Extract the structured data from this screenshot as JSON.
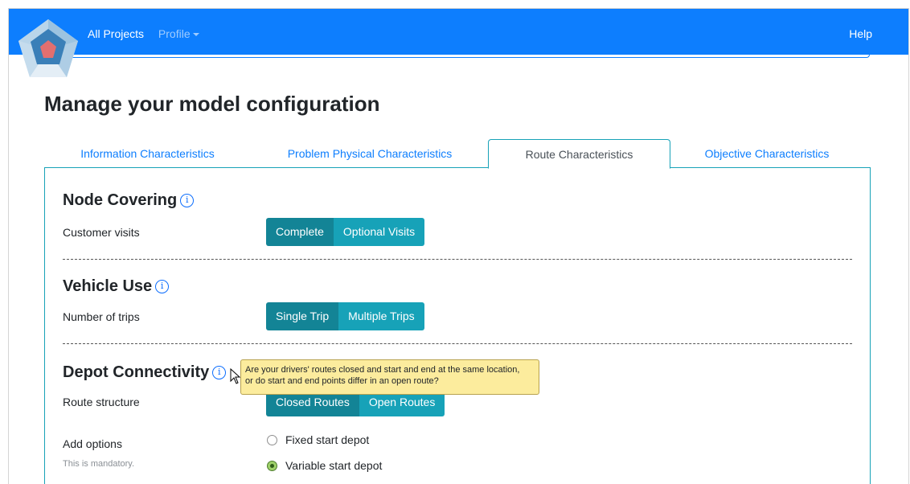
{
  "nav": {
    "all_projects": "All Projects",
    "profile": "Profile",
    "help": "Help"
  },
  "page": {
    "title": "Manage your model configuration"
  },
  "tabs": [
    {
      "label": "Information Characteristics",
      "active": false
    },
    {
      "label": "Problem Physical Characteristics",
      "active": false
    },
    {
      "label": "Route Characteristics",
      "active": true
    },
    {
      "label": "Objective Characteristics",
      "active": false
    }
  ],
  "sections": {
    "node_covering": {
      "title": "Node Covering",
      "field_label": "Customer visits",
      "options": [
        "Complete",
        "Optional Visits"
      ],
      "selected": "Complete"
    },
    "vehicle_use": {
      "title": "Vehicle Use",
      "field_label": "Number of trips",
      "options": [
        "Single Trip",
        "Multiple Trips"
      ],
      "selected": "Single Trip"
    },
    "depot_connectivity": {
      "title": "Depot Connectivity",
      "field_label": "Route structure",
      "options": [
        "Closed Routes",
        "Open Routes"
      ],
      "selected": "Closed Routes",
      "tooltip_line1": "Are your drivers' routes closed and start and end at the same location,",
      "tooltip_line2": "or do start and end points differ in an open route?",
      "add_options_label": "Add options",
      "mandatory_hint": "This is mandatory.",
      "radio_options": [
        {
          "label": "Fixed start depot",
          "checked": false
        },
        {
          "label": "Variable start depot",
          "checked": true
        }
      ]
    }
  },
  "icons": {
    "info": "info-icon",
    "logo": "pentagon-logo",
    "caret": "caret-down-icon",
    "cursor": "mouse-pointer-icon"
  },
  "colors": {
    "navbar": "#0d7efe",
    "accent_teal": "#17a2b8",
    "selected_teal": "#138496",
    "link_blue": "#0d7efe",
    "tooltip_bg": "#fcec9d"
  }
}
